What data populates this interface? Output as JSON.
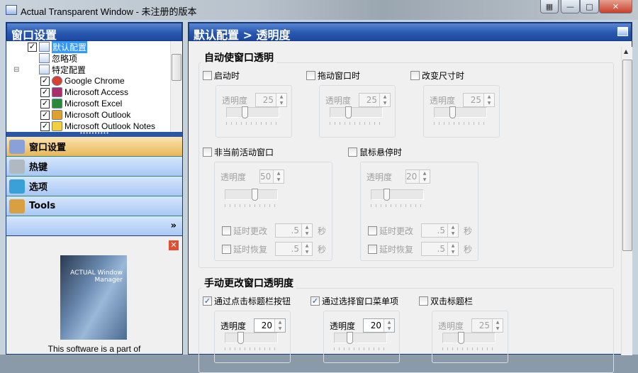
{
  "window": {
    "title": "Actual Transparent Window - 未注册的版本",
    "buttons": {
      "extra": "▦",
      "minimize": "—",
      "maximize": "□",
      "close": "✕"
    }
  },
  "left": {
    "header": "窗口设置",
    "tree": [
      {
        "label": "默认配置",
        "checked": true,
        "selected": true,
        "indent": 0
      },
      {
        "label": "忽略项",
        "checked": null,
        "indent": 0
      },
      {
        "label": "特定配置",
        "checked": null,
        "indent": 0,
        "expander": "⊟"
      },
      {
        "label": "Google Chrome",
        "checked": true,
        "indent": 1,
        "color": "#d84030"
      },
      {
        "label": "Microsoft Access",
        "checked": true,
        "indent": 1,
        "color": "#a8306a"
      },
      {
        "label": "Microsoft Excel",
        "checked": true,
        "indent": 1,
        "color": "#2a8a3a"
      },
      {
        "label": "Microsoft Outlook",
        "checked": true,
        "indent": 1,
        "color": "#e0a030"
      },
      {
        "label": "Microsoft Outlook Notes",
        "checked": true,
        "indent": 1,
        "color": "#f0d040"
      }
    ],
    "nav": [
      {
        "label": "窗口设置",
        "active": true,
        "color": "#8aa0d8"
      },
      {
        "label": "热键",
        "color": "#b0b8c0"
      },
      {
        "label": "选项",
        "color": "#3aa0d8"
      },
      {
        "label": "Tools",
        "color": "#d8a040"
      }
    ],
    "nav_more": "»",
    "promo": {
      "box_title": "ACTUAL Window Manager",
      "text": "This software is a part of"
    }
  },
  "right": {
    "header": "默认配置 > 透明度",
    "auto": {
      "title": "自动使窗口透明",
      "items": [
        {
          "label": "启动时",
          "checked": false,
          "opacity": 25
        },
        {
          "label": "拖动窗口时",
          "checked": false,
          "opacity": 25
        },
        {
          "label": "改变尺寸时",
          "checked": false,
          "opacity": 25
        }
      ],
      "items2": [
        {
          "label": "非当前活动窗口",
          "checked": false,
          "opacity": 50,
          "delay_change": ".5",
          "delay_restore": ".5"
        },
        {
          "label": "鼠标悬停时",
          "checked": false,
          "opacity": 20,
          "delay_change": ".5",
          "delay_restore": ".5"
        }
      ]
    },
    "manual": {
      "title": "手动更改窗口透明度",
      "items": [
        {
          "label": "通过点击标题栏按钮",
          "checked": true,
          "opacity": 20
        },
        {
          "label": "通过选择窗口菜单项",
          "checked": true,
          "opacity": 20
        },
        {
          "label": "双击标题栏",
          "checked": false,
          "opacity": 25
        }
      ]
    },
    "labels": {
      "opacity": "透明度",
      "delay_change": "延时更改",
      "delay_restore": "延时恢复",
      "seconds": "秒"
    }
  }
}
